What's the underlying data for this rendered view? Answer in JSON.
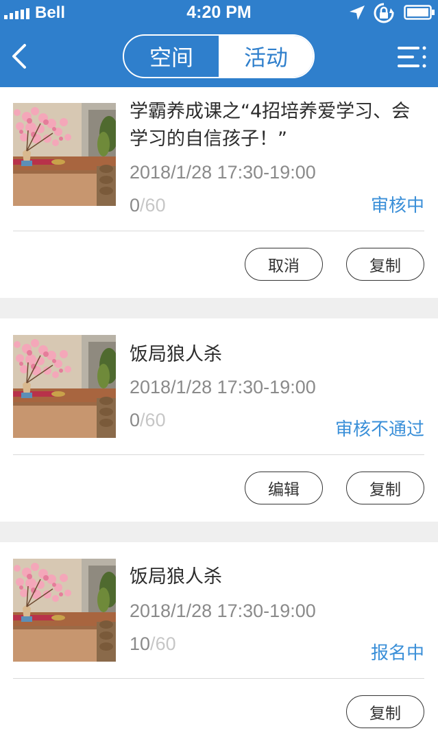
{
  "status_bar": {
    "carrier": "Bell",
    "time": "4:20 PM",
    "icons": [
      "signal-bars-icon",
      "location-arrow-icon",
      "rotation-lock-icon",
      "battery-icon"
    ]
  },
  "nav": {
    "back_icon": "chevron-left-icon",
    "tabs": [
      {
        "label": "空间",
        "selected": false
      },
      {
        "label": "活动",
        "selected": true
      }
    ],
    "menu_icon": "menu-list-icon",
    "colors": {
      "bar": "#2f7fcc",
      "accent_status": "#3a8fd8",
      "separator": "#efefef"
    }
  },
  "activities": [
    {
      "title": "学霸养成课之“4招培养爱学习、会学习的自信孩子！”",
      "time": "2018/1/28 17:30-19:00",
      "count_current": "0",
      "count_sep": "/",
      "count_max": "60",
      "status": "审核中",
      "actions": [
        "取消",
        "复制"
      ]
    },
    {
      "title": "饭局狼人杀",
      "time": "2018/1/28 17:30-19:00",
      "count_current": "0",
      "count_sep": "/",
      "count_max": "60",
      "status": "审核不通过",
      "actions": [
        "编辑",
        "复制"
      ]
    },
    {
      "title": "饭局狼人杀",
      "time": "2018/1/28 17:30-19:00",
      "count_current": "10",
      "count_sep": "/",
      "count_max": "60",
      "status": "报名中",
      "actions": [
        "复制"
      ]
    }
  ]
}
